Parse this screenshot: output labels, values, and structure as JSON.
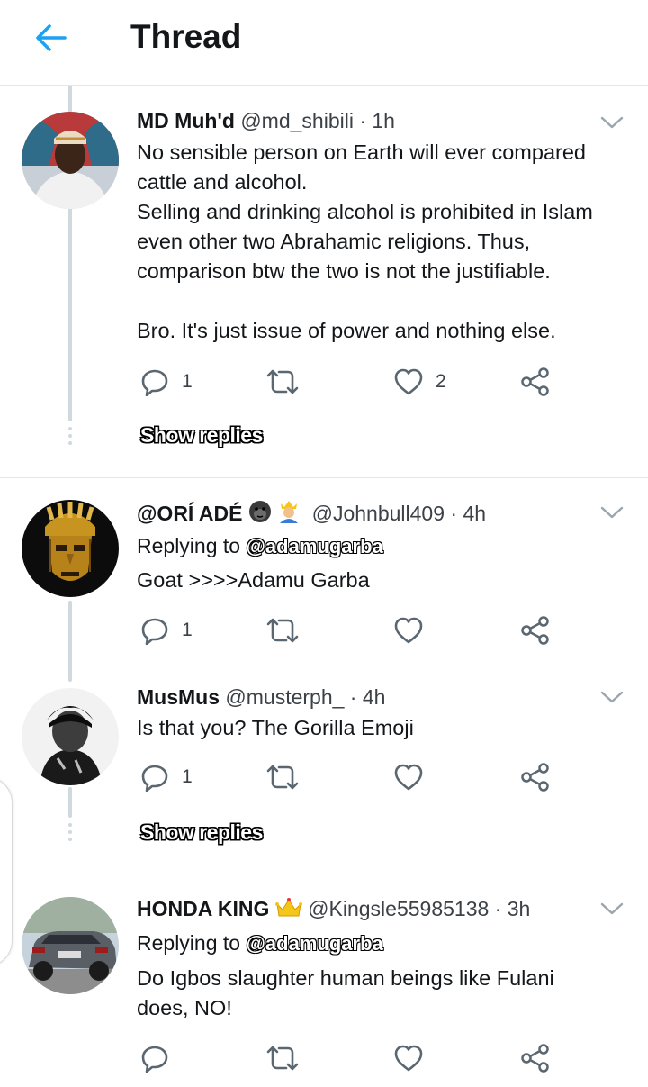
{
  "header": {
    "title": "Thread"
  },
  "tweets": [
    {
      "name": "MD Muh'd",
      "handle": "@md_shibili",
      "time": "· 1h",
      "lines": [
        "No sensible person on Earth will ever compared cattle and alcohol.",
        "Selling and drinking alcohol is prohibited in Islam even other two Abrahamic religions. Thus, comparison btw the two is not the justifiable.",
        "",
        "Bro. It's just issue of power and nothing else."
      ],
      "reply_count": "1",
      "like_count": "2",
      "show_replies": "Show replies"
    },
    {
      "name": "@ORÍ ADÉ",
      "name_emojis": [
        "gorilla-emoji",
        "king-emoji"
      ],
      "handle": "@Johnbull409",
      "time": "· 4h",
      "replying_to_label": "Replying to ",
      "replying_to_handle": "@adamugarba",
      "text": "Goat >>>>Adamu Garba",
      "reply_count": "1"
    },
    {
      "name": "MusMus",
      "handle": "@musterph_",
      "time": "· 4h",
      "text": "Is that you? The Gorilla Emoji",
      "reply_count": "1",
      "show_replies": "Show replies"
    },
    {
      "name": "HONDA KING",
      "name_emojis": [
        "crown-emoji"
      ],
      "handle": "@Kingsle55985138",
      "time": "· 3h",
      "replying_to_label": "Replying to ",
      "replying_to_handle": "@adamugarba",
      "text": "Do Igbos slaughter human beings like Fulani does, NO!"
    }
  ],
  "colors": {
    "accent": "#1da1f2",
    "icon_gray": "#5b6770",
    "divider": "#e1e8ed",
    "thread_line": "#cfd9de"
  }
}
